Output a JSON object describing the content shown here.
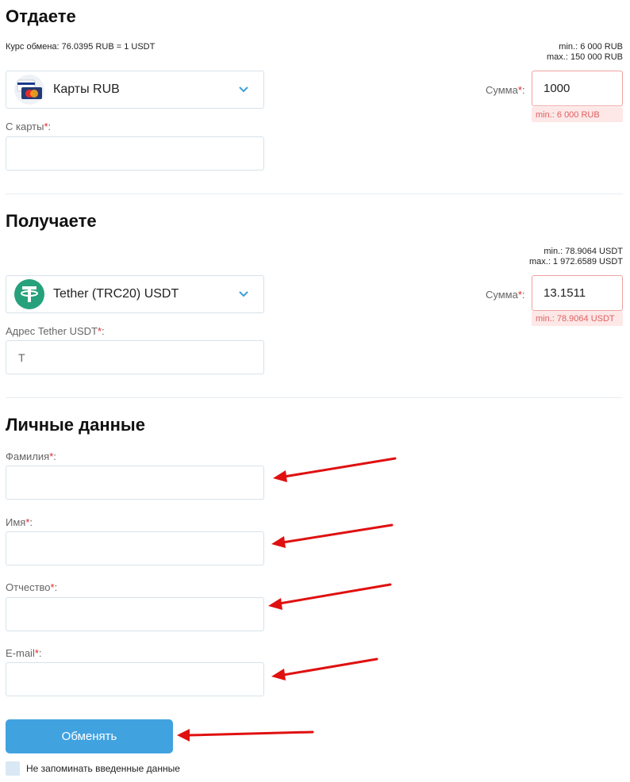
{
  "give": {
    "heading": "Отдаете",
    "rate": "Курс обмена: 76.0395 RUB = 1 USDT",
    "min": "min.: 6 000 RUB",
    "max": "max.: 150 000 RUB",
    "currency": "Карты RUB",
    "sum_label": "Сумма",
    "sum_value": "1000",
    "sum_error": "min.: 6 000 RUB",
    "card_label": "С карты",
    "card_value": ""
  },
  "receive": {
    "heading": "Получаете",
    "min": "min.: 78.9064 USDT",
    "max": "max.: 1 972.6589 USDT",
    "currency": "Tether (TRC20) USDT",
    "sum_label": "Сумма",
    "sum_value": "13.1511",
    "sum_error": "min.: 78.9064 USDT",
    "address_label": "Адрес Tether USDT",
    "address_value": "T"
  },
  "personal": {
    "heading": "Личные данные",
    "surname_label": "Фамилия",
    "name_label": "Имя",
    "patronymic_label": "Отчество",
    "email_label": "E-mail"
  },
  "required_mark": "*",
  "colon": ":",
  "submit_label": "Обменять",
  "remember_label": "Не запоминать введенные данные",
  "colors": {
    "accent": "#41a2e0",
    "required": "#e0262a",
    "error_bg": "#fde7e7",
    "error_text": "#e06060",
    "tether": "#26a17b",
    "annotation_arrow": "#e01010"
  },
  "icons": {
    "rub_cards": "visa-mastercard-icon",
    "tether": "tether-icon",
    "dropdown": "chevron-down-icon"
  }
}
